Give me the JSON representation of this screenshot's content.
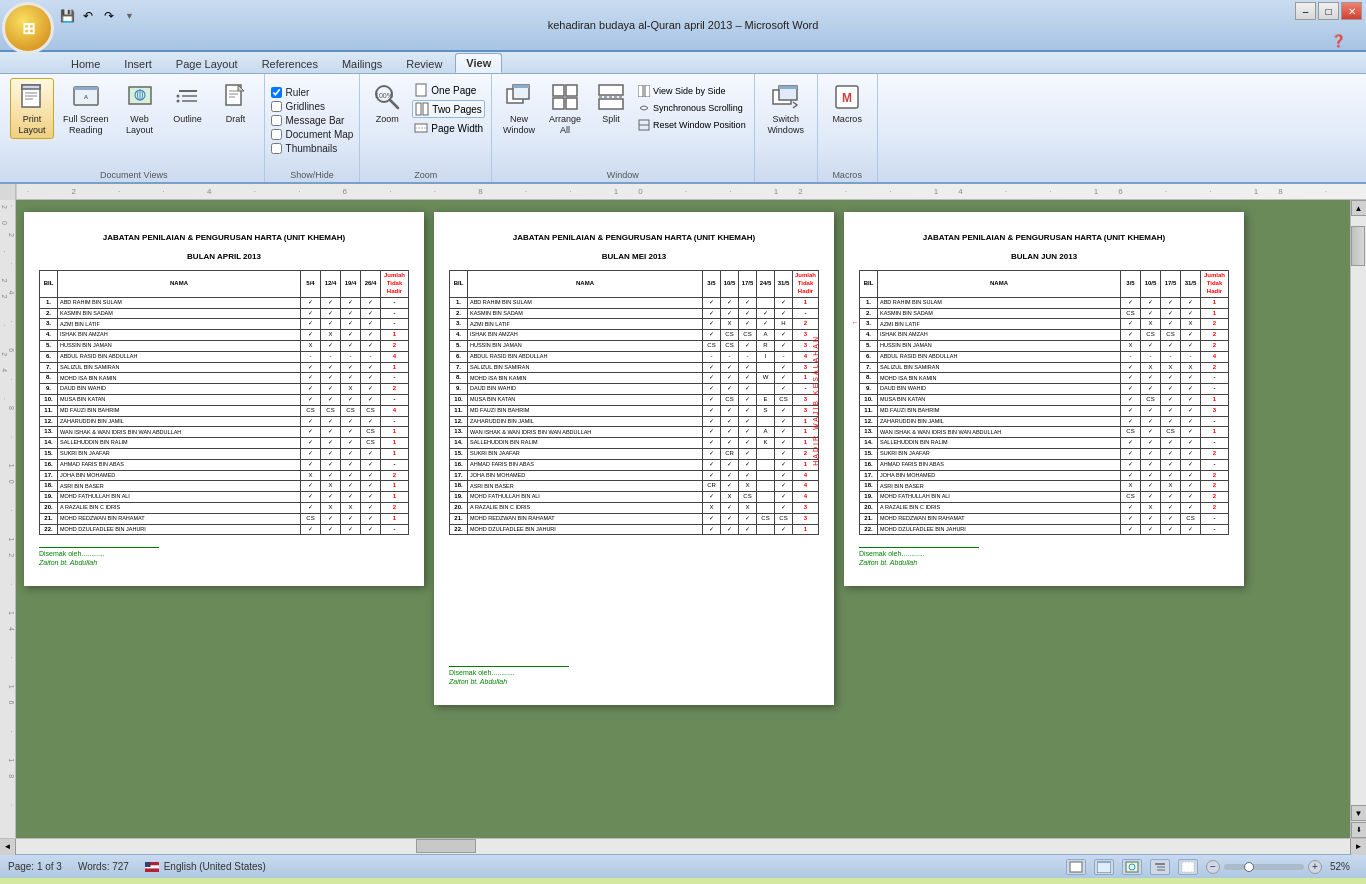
{
  "window": {
    "title": "kehadiran budaya al-Quran april 2013 – Microsoft Word",
    "min_label": "–",
    "max_label": "□",
    "close_label": "✕"
  },
  "ribbon_tabs": [
    "Home",
    "Insert",
    "Page Layout",
    "References",
    "Mailings",
    "Review",
    "View"
  ],
  "active_tab": "View",
  "ribbon_groups": {
    "document_views": {
      "label": "Document Views",
      "buttons": [
        {
          "id": "print-layout",
          "label": "Print\nLayout",
          "icon": "📄"
        },
        {
          "id": "full-screen",
          "label": "Full Screen\nReading",
          "icon": "📖"
        },
        {
          "id": "web-layout",
          "label": "Web\nLayout",
          "icon": "🌐"
        },
        {
          "id": "outline",
          "label": "Outline",
          "icon": "≡"
        },
        {
          "id": "draft",
          "label": "Draft",
          "icon": "📝"
        }
      ]
    },
    "show_hide": {
      "label": "Show/Hide",
      "checkboxes": [
        {
          "id": "ruler",
          "label": "Ruler",
          "checked": true
        },
        {
          "id": "gridlines",
          "label": "Gridlines",
          "checked": false
        },
        {
          "id": "message-bar",
          "label": "Message Bar",
          "checked": false
        },
        {
          "id": "doc-map",
          "label": "Document Map",
          "checked": false
        },
        {
          "id": "thumbnails",
          "label": "Thumbnails",
          "checked": false
        }
      ]
    },
    "zoom": {
      "label": "Zoom",
      "zoom_value": "100%",
      "buttons": [
        {
          "id": "zoom-btn",
          "label": "Zoom",
          "icon": "🔍"
        },
        {
          "id": "one-page",
          "label": "One Page",
          "icon": "📄"
        },
        {
          "id": "two-pages",
          "label": "Two Pages",
          "icon": "📋"
        },
        {
          "id": "page-width",
          "label": "Page Width",
          "icon": "↔"
        }
      ]
    },
    "window": {
      "label": "Window",
      "buttons": [
        {
          "id": "new-window",
          "label": "New\nWindow",
          "icon": "🗗"
        },
        {
          "id": "arrange-all",
          "label": "Arrange\nAll",
          "icon": "⊞"
        },
        {
          "id": "split",
          "label": "Split",
          "icon": "⊟"
        },
        {
          "id": "view-side",
          "label": "View Side by Side",
          "icon": ""
        },
        {
          "id": "sync-scroll",
          "label": "Synchronous Scrolling",
          "icon": ""
        },
        {
          "id": "reset-window",
          "label": "Reset Window Position",
          "icon": ""
        }
      ]
    },
    "macros": {
      "label": "Macros",
      "buttons": [
        {
          "id": "macros",
          "label": "Macros",
          "icon": ""
        }
      ]
    }
  },
  "pages": [
    {
      "id": "page1",
      "title1": "JABATAN PENILAIAN & PENGURUSAN HARTA (UNIT KHEMAH)",
      "title2": "BULAN APRIL 2013",
      "columns": [
        "BIL",
        "NAMA",
        "5/4",
        "12/4",
        "19/4",
        "26/4",
        "Jumlah\nTidak\nHadir"
      ],
      "rows": [
        {
          "no": "1.",
          "name": "ABD RAHIM BIN SULAM",
          "v1": "✓",
          "v2": "✓",
          "v3": "✓",
          "v4": "✓",
          "total": "-"
        },
        {
          "no": "2.",
          "name": "KASMIN BIN SADAM",
          "v1": "✓",
          "v2": "✓",
          "v3": "✓",
          "v4": "✓",
          "total": "-"
        },
        {
          "no": "3.",
          "name": "AZMI BIN LATIF",
          "v1": "✓",
          "v2": "✓",
          "v3": "✓",
          "v4": "✓",
          "total": "-"
        },
        {
          "no": "4.",
          "name": "ISHAK BIN AMZAH",
          "v1": "✓",
          "v2": "X",
          "v3": "✓",
          "v4": "✓",
          "total": "1"
        },
        {
          "no": "5.",
          "name": "HUSSIN BIN JAMAN",
          "v1": "X",
          "v2": "✓",
          "v3": "✓",
          "v4": "✓",
          "total": "2"
        },
        {
          "no": "6.",
          "name": "ABDUL RASID BIN ABDULLAH",
          "v1": "-",
          "v2": "-",
          "v3": "-",
          "v4": "-",
          "total": "4"
        },
        {
          "no": "7.",
          "name": "SALIZUL BIN SAMIRAN",
          "v1": "✓",
          "v2": "✓",
          "v3": "✓",
          "v4": "✓",
          "total": "1"
        },
        {
          "no": "8.",
          "name": "MOHD ISA BIN KAMIN",
          "v1": "✓",
          "v2": "✓",
          "v3": "✓",
          "v4": "✓",
          "total": "-"
        },
        {
          "no": "9.",
          "name": "DAUD BIN WAHID",
          "v1": "✓",
          "v2": "✓",
          "v3": "X",
          "v4": "✓",
          "total": "2"
        },
        {
          "no": "10.",
          "name": "MUSA BIN KATAN",
          "v1": "✓",
          "v2": "✓",
          "v3": "✓",
          "v4": "✓",
          "total": "-"
        },
        {
          "no": "11.",
          "name": "MD FAUZI BIN BAHRIM",
          "v1": "CS",
          "v2": "CS",
          "v3": "CS",
          "v4": "CS",
          "total": "4"
        },
        {
          "no": "12.",
          "name": "ZAHARUDDIN BIN JAMIL",
          "v1": "✓",
          "v2": "✓",
          "v3": "✓",
          "v4": "✓",
          "total": "-"
        },
        {
          "no": "13.",
          "name": "WAN ISHAK & WAN IDRIS BIN WAN ABDULLAH",
          "v1": "✓",
          "v2": "✓",
          "v3": "✓",
          "v4": "CS",
          "total": "1"
        },
        {
          "no": "14.",
          "name": "SALLEHUDDIN BIN RALIM",
          "v1": "✓",
          "v2": "✓",
          "v3": "✓",
          "v4": "CS",
          "total": "1"
        },
        {
          "no": "15.",
          "name": "SUKRI BIN JAAFAR",
          "v1": "✓",
          "v2": "✓",
          "v3": "✓",
          "v4": "✓",
          "total": "1"
        },
        {
          "no": "16.",
          "name": "AHMAD FARIS BIN ABAS",
          "v1": "✓",
          "v2": "✓",
          "v3": "✓",
          "v4": "✓",
          "total": "-"
        },
        {
          "no": "17.",
          "name": "JOHA BIN MOHAMED",
          "v1": "X",
          "v2": "✓",
          "v3": "✓",
          "v4": "✓",
          "total": "2"
        },
        {
          "no": "18.",
          "name": "ASRI BIN BASER",
          "v1": "✓",
          "v2": "X",
          "v3": "✓",
          "v4": "✓",
          "total": "1"
        },
        {
          "no": "19.",
          "name": "MOHD FATHULLAH BIN ALI",
          "v1": "✓",
          "v2": "✓",
          "v3": "✓",
          "v4": "✓",
          "total": "1"
        },
        {
          "no": "20.",
          "name": "A RAZALIE BIN C IDRIS",
          "v1": "✓",
          "v2": "X",
          "v3": "X",
          "v4": "✓",
          "total": "2"
        },
        {
          "no": "21.",
          "name": "MOHD REDZWAN BIN RAHAMAT",
          "v1": "CS",
          "v2": "✓",
          "v3": "✓",
          "v4": "✓",
          "total": "1"
        },
        {
          "no": "22.",
          "name": "MOHD DZULFADLEE BIN JAHURI",
          "v1": "✓",
          "v2": "✓",
          "v3": "✓",
          "v4": "✓",
          "total": "-"
        }
      ],
      "signature_label": "Disemak oleh...........",
      "signature_name": "Zaiton bt. Abdullah"
    },
    {
      "id": "page2",
      "title1": "JABATAN PENILAIAN & PENGURUSAN HARTA (UNIT KHEMAH)",
      "title2": "BULAN MEI 2013",
      "columns": [
        "BIL",
        "NAMA",
        "3/5",
        "10/5",
        "17/5",
        "24/5",
        "31/5",
        "Jumlah\nTidak\nHadir"
      ],
      "rows": [
        {
          "no": "1.",
          "name": "ABD RAHIM BIN SULAM",
          "v1": "✓",
          "v2": "✓",
          "v3": "✓",
          "v4": "",
          "v5": "✓",
          "total": "1"
        },
        {
          "no": "2.",
          "name": "KASMIN BIN SADAM",
          "v1": "✓",
          "v2": "✓",
          "v3": "✓",
          "v4": "✓",
          "v5": "✓",
          "total": "-"
        },
        {
          "no": "3.",
          "name": "AZMI BIN LATIF",
          "v1": "✓",
          "v2": "X",
          "v3": "✓",
          "v4": "✓",
          "v5": "H",
          "total": "2"
        },
        {
          "no": "4.",
          "name": "ISHAK BIN AMZAH",
          "v1": "✓",
          "v2": "CS",
          "v3": "CS",
          "v4": "A",
          "v5": "✓",
          "total": "3"
        },
        {
          "no": "5.",
          "name": "HUSSIN BIN JAMAN",
          "v1": "CS",
          "v2": "CS",
          "v3": "✓",
          "v4": "R",
          "v5": "✓",
          "total": "3"
        },
        {
          "no": "6.",
          "name": "ABDUL RASID BIN ABDULLAH",
          "v1": "-",
          "v2": "-",
          "v3": "-",
          "v4": "I",
          "v5": "-",
          "total": "4"
        },
        {
          "no": "7.",
          "name": "SALIZUL BIN SAMIRAN",
          "v1": "✓",
          "v2": "✓",
          "v3": "✓",
          "v4": "",
          "v5": "✓",
          "total": "3"
        },
        {
          "no": "8.",
          "name": "MOHD ISA BIN KAMIN",
          "v1": "✓",
          "v2": "✓",
          "v3": "✓",
          "v4": "W",
          "v5": "✓",
          "total": "1"
        },
        {
          "no": "9.",
          "name": "DAUD BIN WAHID",
          "v1": "✓",
          "v2": "✓",
          "v3": "✓",
          "v4": "",
          "v5": "✓",
          "total": "-"
        },
        {
          "no": "10.",
          "name": "MUSA BIN KATAN",
          "v1": "✓",
          "v2": "CS",
          "v3": "✓",
          "v4": "E",
          "v5": "CS",
          "total": "3"
        },
        {
          "no": "11.",
          "name": "MD FAUZI BIN BAHRIM",
          "v1": "✓",
          "v2": "✓",
          "v3": "✓",
          "v4": "S",
          "v5": "✓",
          "total": "3"
        },
        {
          "no": "12.",
          "name": "ZAHARUDDIN BIN JAMIL",
          "v1": "✓",
          "v2": "✓",
          "v3": "✓",
          "v4": "",
          "v5": "✓",
          "total": "1"
        },
        {
          "no": "13.",
          "name": "WAN ISHAK & WAN IDRIS BIN WAN ABDULLAH",
          "v1": "✓",
          "v2": "✓",
          "v3": "✓",
          "v4": "A",
          "v5": "✓",
          "total": "1"
        },
        {
          "no": "14.",
          "name": "SALLEHUDDIN BIN RALIM",
          "v1": "✓",
          "v2": "✓",
          "v3": "✓",
          "v4": "K",
          "v5": "✓",
          "total": "1"
        },
        {
          "no": "15.",
          "name": "SUKRI BIN JAAFAR",
          "v1": "✓",
          "v2": "CR",
          "v3": "✓",
          "v4": "",
          "v5": "✓",
          "total": "2"
        },
        {
          "no": "16.",
          "name": "AHMAD FARIS BIN ABAS",
          "v1": "✓",
          "v2": "✓",
          "v3": "✓",
          "v4": "",
          "v5": "✓",
          "total": "1"
        },
        {
          "no": "17.",
          "name": "JOHA BIN MOHAMED",
          "v1": "✓",
          "v2": "✓",
          "v3": "✓",
          "v4": "",
          "v5": "✓",
          "total": "4"
        },
        {
          "no": "18.",
          "name": "ASRI BIN BASER",
          "v1": "CR",
          "v2": "✓",
          "v3": "X",
          "v4": "",
          "v5": "✓",
          "total": "4"
        },
        {
          "no": "19.",
          "name": "MOHD FATHULLAH BIN ALI",
          "v1": "✓",
          "v2": "X",
          "v3": "CS",
          "v4": "",
          "v5": "✓",
          "total": "4"
        },
        {
          "no": "20.",
          "name": "A RAZALIE BIN C IDRIS",
          "v1": "X",
          "v2": "✓",
          "v3": "X",
          "v4": "",
          "v5": "✓",
          "total": "3"
        },
        {
          "no": "21.",
          "name": "MOHD REDZWAN BIN RAHAMAT",
          "v1": "✓",
          "v2": "✓",
          "v3": "✓",
          "v4": "CS",
          "v5": "CS",
          "total": "3"
        },
        {
          "no": "22.",
          "name": "MOHD DZULFADLEE BIN JAHURI",
          "v1": "✓",
          "v2": "✓",
          "v3": "✓",
          "v4": "",
          "v5": "✓",
          "total": "1"
        }
      ],
      "signature_label": "Disemak oleh...........",
      "signature_name": "Zaiton bt. Abdullah"
    },
    {
      "id": "page3",
      "title1": "JABATAN PENILAIAN & PENGURUSAN HARTA (UNIT KHEMAH)",
      "title2": "BULAN JUN 2013",
      "columns": [
        "BIL",
        "NAMA",
        "3/5",
        "10/5",
        "17/5",
        "31/5",
        "Jumlah\nTidak\nHadir"
      ],
      "rows": [
        {
          "no": "1.",
          "name": "ABD RAHIM BIN SULAM",
          "v1": "✓",
          "v2": "✓",
          "v3": "✓",
          "v4": "✓",
          "total": "1"
        },
        {
          "no": "2.",
          "name": "KASMIN BIN SADAM",
          "v1": "CS",
          "v2": "✓",
          "v3": "✓",
          "v4": "✓",
          "total": "1"
        },
        {
          "no": "3.",
          "name": "AZMI BIN LATIF",
          "v1": "✓",
          "v2": "X",
          "v3": "✓",
          "v4": "X",
          "total": "2"
        },
        {
          "no": "4.",
          "name": "ISHAK BIN AMZAH",
          "v1": "✓",
          "v2": "CS",
          "v3": "CS",
          "v4": "✓",
          "total": "2"
        },
        {
          "no": "5.",
          "name": "HUSSIN BIN JAMAN",
          "v1": "X",
          "v2": "✓",
          "v3": "✓",
          "v4": "✓",
          "total": "2"
        },
        {
          "no": "6.",
          "name": "ABDUL RASID BIN ABDULLAH",
          "v1": "-",
          "v2": "-",
          "v3": "-",
          "v4": "-",
          "total": "4"
        },
        {
          "no": "7.",
          "name": "SALIZUL BIN SAMIRAN",
          "v1": "✓",
          "v2": "X",
          "v3": "X",
          "v4": "X",
          "total": "2"
        },
        {
          "no": "8.",
          "name": "MOHD ISA BIN KAMIN",
          "v1": "✓",
          "v2": "✓",
          "v3": "✓",
          "v4": "✓",
          "total": "-"
        },
        {
          "no": "9.",
          "name": "DAUD BIN WAHID",
          "v1": "✓",
          "v2": "✓",
          "v3": "✓",
          "v4": "✓",
          "total": "-"
        },
        {
          "no": "10.",
          "name": "MUSA BIN KATAN",
          "v1": "✓",
          "v2": "CS",
          "v3": "✓",
          "v4": "✓",
          "total": "1"
        },
        {
          "no": "11.",
          "name": "MD FAUZI BIN BAHRIM",
          "v1": "✓",
          "v2": "✓",
          "v3": "✓",
          "v4": "✓",
          "total": "3"
        },
        {
          "no": "12.",
          "name": "ZAHARUDDIN BIN JAMIL",
          "v1": "✓",
          "v2": "✓",
          "v3": "✓",
          "v4": "✓",
          "total": "-"
        },
        {
          "no": "13.",
          "name": "WAN ISHAK & WAN IDRIS BIN WAN ABDULLAH",
          "v1": "CS",
          "v2": "✓",
          "v3": "CS",
          "v4": "✓",
          "total": "1"
        },
        {
          "no": "14.",
          "name": "SALLEHUDDIN BIN RALIM",
          "v1": "✓",
          "v2": "✓",
          "v3": "✓",
          "v4": "✓",
          "total": "-"
        },
        {
          "no": "15.",
          "name": "SUKRI BIN JAAFAR",
          "v1": "✓",
          "v2": "✓",
          "v3": "✓",
          "v4": "✓",
          "total": "2"
        },
        {
          "no": "16.",
          "name": "AHMAD FARIS BIN ABAS",
          "v1": "✓",
          "v2": "✓",
          "v3": "✓",
          "v4": "✓",
          "total": "-"
        },
        {
          "no": "17.",
          "name": "JOHA BIN MOHAMED",
          "v1": "✓",
          "v2": "✓",
          "v3": "✓",
          "v4": "✓",
          "total": "2"
        },
        {
          "no": "18.",
          "name": "ASRI BIN BASER",
          "v1": "X",
          "v2": "✓",
          "v3": "X",
          "v4": "✓",
          "total": "2"
        },
        {
          "no": "19.",
          "name": "MOHD FATHULLAH BIN ALI",
          "v1": "CS",
          "v2": "✓",
          "v3": "✓",
          "v4": "✓",
          "total": "2"
        },
        {
          "no": "20.",
          "name": "A RAZALIE BIN C IDRIS",
          "v1": "✓",
          "v2": "X",
          "v3": "✓",
          "v4": "✓",
          "total": "2"
        },
        {
          "no": "21.",
          "name": "MOHD REDZWAN BIN RAHAMAT",
          "v1": "✓",
          "v2": "✓",
          "v3": "✓",
          "v4": "CS",
          "total": "-"
        },
        {
          "no": "22.",
          "name": "MOHD DZULFADLEE BIN JAHURI",
          "v1": "✓",
          "v2": "✓",
          "v3": "✓",
          "v4": "✓",
          "total": "-"
        }
      ],
      "signature_label": "Disemak oleh...........",
      "signature_name": "Zaiton bt. Abdullah"
    }
  ],
  "status_bar": {
    "page_info": "Page: 1 of 3",
    "words": "Words: 727",
    "language": "English (United States)",
    "zoom_level": "52%"
  }
}
